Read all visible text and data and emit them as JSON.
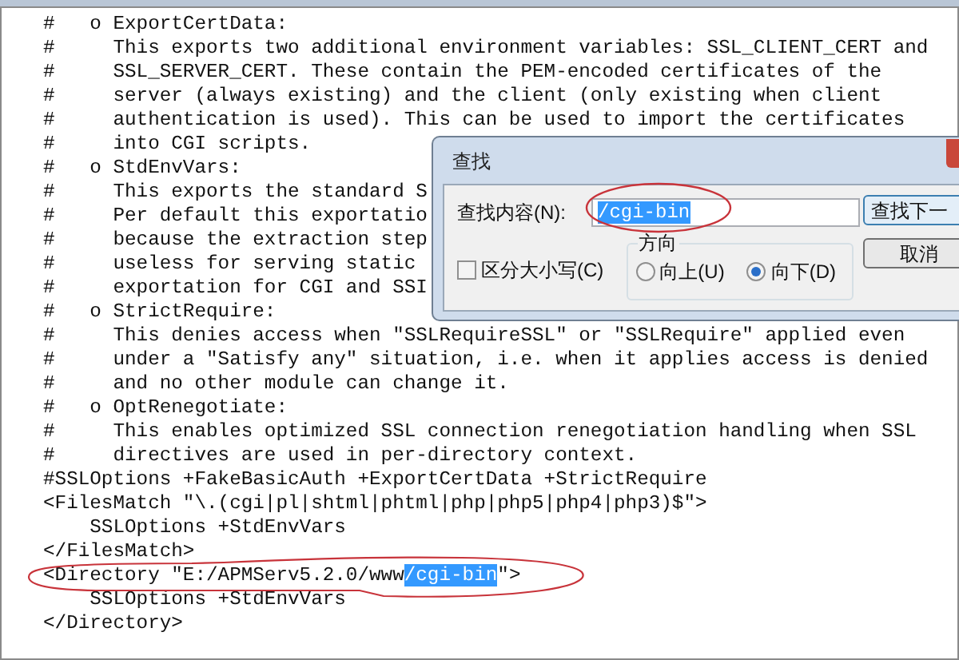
{
  "editor": {
    "lines": [
      {
        "segments": [
          {
            "text": "#   o ExportCertData:",
            "selected": false
          }
        ]
      },
      {
        "segments": [
          {
            "text": "#     This exports two additional environment variables: SSL_CLIENT_CERT and",
            "selected": false
          }
        ]
      },
      {
        "segments": [
          {
            "text": "#     SSL_SERVER_CERT. These contain the PEM-encoded certificates of the",
            "selected": false
          }
        ]
      },
      {
        "segments": [
          {
            "text": "#     server (always existing) and the client (only existing when client",
            "selected": false
          }
        ]
      },
      {
        "segments": [
          {
            "text": "#     authentication is used). This can be used to import the certificates",
            "selected": false
          }
        ]
      },
      {
        "segments": [
          {
            "text": "#     into CGI scripts.",
            "selected": false
          }
        ]
      },
      {
        "segments": [
          {
            "text": "#   o StdEnvVars:",
            "selected": false
          }
        ]
      },
      {
        "segments": [
          {
            "text": "#     This exports the standard S",
            "selected": false
          }
        ]
      },
      {
        "segments": [
          {
            "text": "#     Per default this exportatio",
            "selected": false
          }
        ]
      },
      {
        "segments": [
          {
            "text": "#     because the extraction step",
            "selected": false
          }
        ]
      },
      {
        "segments": [
          {
            "text": "#     useless for serving static",
            "selected": false
          }
        ]
      },
      {
        "segments": [
          {
            "text": "#     exportation for CGI and SSI",
            "selected": false
          }
        ]
      },
      {
        "segments": [
          {
            "text": "#   o StrictRequire:",
            "selected": false
          }
        ]
      },
      {
        "segments": [
          {
            "text": "#     This denies access when \"SSLRequireSSL\" or \"SSLRequire\" applied even",
            "selected": false
          }
        ]
      },
      {
        "segments": [
          {
            "text": "#     under a \"Satisfy any\" situation, i.e. when it applies access is denied",
            "selected": false
          }
        ]
      },
      {
        "segments": [
          {
            "text": "#     and no other module can change it.",
            "selected": false
          }
        ]
      },
      {
        "segments": [
          {
            "text": "#   o OptRenegotiate:",
            "selected": false
          }
        ]
      },
      {
        "segments": [
          {
            "text": "#     This enables optimized SSL connection renegotiation handling when SSL",
            "selected": false
          }
        ]
      },
      {
        "segments": [
          {
            "text": "#     directives are used in per-directory context.",
            "selected": false
          }
        ]
      },
      {
        "segments": [
          {
            "text": "#SSLOptions +FakeBasicAuth +ExportCertData +StrictRequire",
            "selected": false
          }
        ]
      },
      {
        "segments": [
          {
            "text": "<FilesMatch \"\\.(cgi|pl|shtml|phtml|php|php5|php4|php3)$\">",
            "selected": false
          }
        ]
      },
      {
        "segments": [
          {
            "text": "    SSLOptions +StdEnvVars",
            "selected": false
          }
        ]
      },
      {
        "segments": [
          {
            "text": "</FilesMatch>",
            "selected": false
          }
        ]
      },
      {
        "segments": [
          {
            "text": "<Directory \"E:/APMServ5.2.0/www",
            "selected": false
          },
          {
            "text": "/cgi-bin",
            "selected": true
          },
          {
            "text": "\">",
            "selected": false
          }
        ]
      },
      {
        "segments": [
          {
            "text": "    SSLOptions +StdEnvVars",
            "selected": false
          }
        ]
      },
      {
        "segments": [
          {
            "text": "</Directory>",
            "selected": false
          }
        ]
      }
    ]
  },
  "find_dialog": {
    "title": "查找",
    "find_label": "查找内容(N):",
    "find_value": "/cgi-bin",
    "find_value_selected": true,
    "find_next_button": "查找下一",
    "cancel_button": "取消",
    "match_case": {
      "label": "区分大小写(C)",
      "checked": false
    },
    "direction": {
      "label": "方向",
      "options": [
        {
          "label": "向上(U)",
          "selected": false
        },
        {
          "label": "向下(D)",
          "selected": true
        }
      ]
    }
  }
}
